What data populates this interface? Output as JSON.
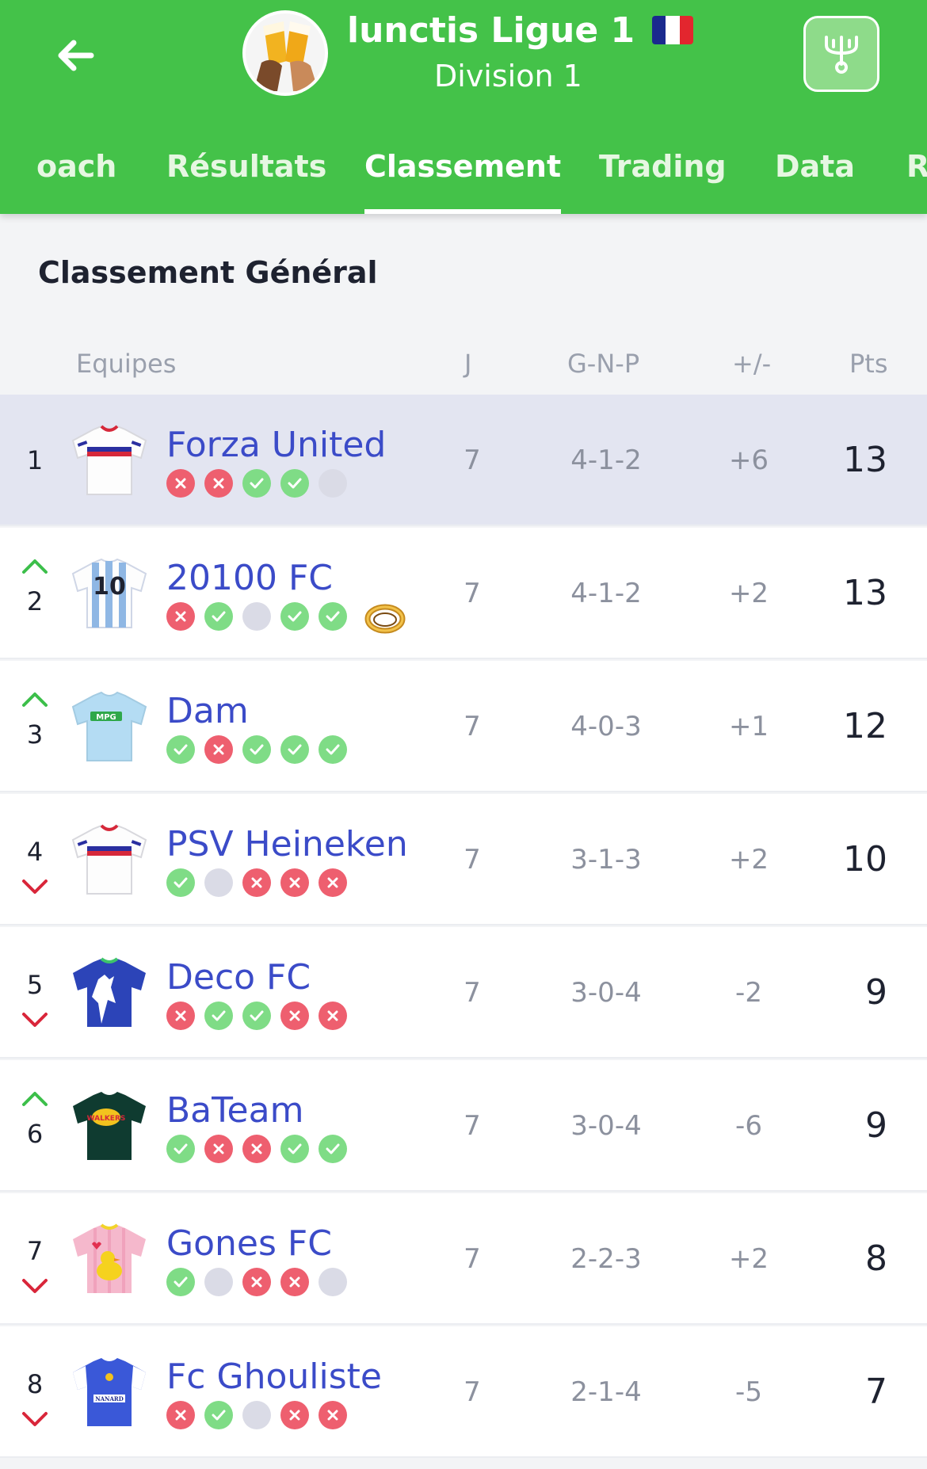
{
  "header": {
    "league_name": "lunctis Ligue 1",
    "division": "Division 1",
    "back_icon": "arrow-left-icon",
    "trophy_icon": "trophy-icon",
    "flag_colors": [
      "#1a2a8e",
      "#ffffff",
      "#e3262e"
    ]
  },
  "tabs": [
    {
      "label": "oach",
      "active": false
    },
    {
      "label": "Résultats",
      "active": false
    },
    {
      "label": "Classement",
      "active": true
    },
    {
      "label": "Trading",
      "active": false
    },
    {
      "label": "Data",
      "active": false
    },
    {
      "label": "R",
      "active": false
    }
  ],
  "section_title": "Classement Général",
  "columns": {
    "team": "Equipes",
    "played": "J",
    "record": "G-N-P",
    "diff": "+/-",
    "points": "Pts"
  },
  "colors": {
    "primary": "#44c249",
    "team_link": "#3b4bc8",
    "win": "#7fdc86",
    "loss": "#ee5f6f",
    "pending": "#dadbe6",
    "up": "#3cbf4a",
    "down": "#d9263a"
  },
  "standings": [
    {
      "rank": "1",
      "trend": "none",
      "name": "Forza United",
      "form": [
        "L",
        "L",
        "W",
        "W",
        "D"
      ],
      "played": "7",
      "record": "4-1-2",
      "diff": "+6",
      "points": "13",
      "jersey": "white-stripes",
      "highlight": true
    },
    {
      "rank": "2",
      "trend": "up",
      "name": "20100 FC",
      "form": [
        "L",
        "W",
        "D",
        "W",
        "W"
      ],
      "played": "7",
      "record": "4-1-2",
      "diff": "+2",
      "points": "13",
      "jersey": "argentina-10",
      "badge": "ring-icon"
    },
    {
      "rank": "3",
      "trend": "up",
      "name": "Dam",
      "form": [
        "W",
        "L",
        "W",
        "W",
        "W"
      ],
      "played": "7",
      "record": "4-0-3",
      "diff": "+1",
      "points": "12",
      "jersey": "sky-mpg"
    },
    {
      "rank": "4",
      "trend": "down",
      "name": "PSV Heineken",
      "form": [
        "W",
        "D",
        "L",
        "L",
        "L"
      ],
      "played": "7",
      "record": "3-1-3",
      "diff": "+2",
      "points": "10",
      "jersey": "white-stripes"
    },
    {
      "rank": "5",
      "trend": "down",
      "name": "Deco FC",
      "form": [
        "L",
        "W",
        "W",
        "L",
        "L"
      ],
      "played": "7",
      "record": "3-0-4",
      "diff": "-2",
      "points": "9",
      "jersey": "blue-goat"
    },
    {
      "rank": "6",
      "trend": "up",
      "name": "BaTeam",
      "form": [
        "W",
        "L",
        "L",
        "W",
        "W"
      ],
      "played": "7",
      "record": "3-0-4",
      "diff": "-6",
      "points": "9",
      "jersey": "dark-walkers"
    },
    {
      "rank": "7",
      "trend": "down",
      "name": "Gones FC",
      "form": [
        "W",
        "D",
        "L",
        "L",
        "D"
      ],
      "played": "7",
      "record": "2-2-3",
      "diff": "+2",
      "points": "8",
      "jersey": "pink-duck"
    },
    {
      "rank": "8",
      "trend": "down",
      "name": "Fc Ghouliste",
      "form": [
        "L",
        "W",
        "D",
        "L",
        "L"
      ],
      "played": "7",
      "record": "2-1-4",
      "diff": "-5",
      "points": "7",
      "jersey": "blue-nanard"
    }
  ]
}
